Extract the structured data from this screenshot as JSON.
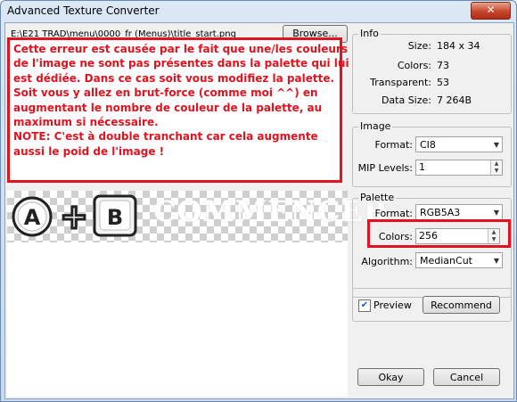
{
  "window": {
    "title": "Advanced Texture Converter",
    "close_glyph": "✕"
  },
  "file": {
    "path": "E:\\E21 TRAD\\menu\\0000_fr (Menus)\\title_start.png",
    "browse_label": "Browse..."
  },
  "annotation": {
    "lines": [
      "Cette erreur est causée par le fait que une/les couleurs",
      "de l'image ne sont pas présentes dans la palette qui lui",
      "est dédiée. Dans ce cas soit vous modifiez la palette.",
      "Soit vous y allez en brut-force (comme moi ^^) en",
      "augmentant le nombre de couleur de la palette, au",
      "maximum si nécessaire.",
      "NOTE: C'est à double tranchant car cela augmente",
      "aussi le poid de l'image !"
    ],
    "color": "#e0131f"
  },
  "preview": {
    "text": "COMMENCER",
    "button_a": "A",
    "plus": "+",
    "button_b": "B"
  },
  "info": {
    "title": "Info",
    "size_label": "Size:",
    "size_value": "184 x 34",
    "colors_label": "Colors:",
    "colors_value": "73",
    "transparent_label": "Transparent:",
    "transparent_value": "53",
    "datasize_label": "Data Size:",
    "datasize_value": "7 264B"
  },
  "image": {
    "title": "Image",
    "format_label": "Format:",
    "format_value": "CI8",
    "mip_label": "MIP Levels:",
    "mip_value": "1"
  },
  "palette": {
    "title": "Palette",
    "format_label": "Format:",
    "format_value": "RGB5A3",
    "colors_label": "Colors:",
    "colors_value": "256",
    "algorithm_label": "Algorithm:",
    "algorithm_value": "MedianCut"
  },
  "actions": {
    "preview_label": "Preview",
    "preview_checked": true,
    "recommend_label": "Recommend",
    "okay_label": "Okay",
    "cancel_label": "Cancel"
  }
}
